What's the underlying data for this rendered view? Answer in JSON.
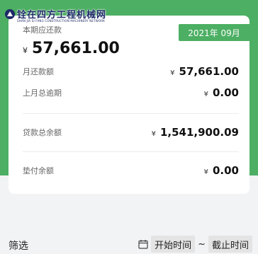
{
  "watermark": {
    "title": "铨在四方工程机械网",
    "subtitle": "SHAN JIA SI FANG CONSTRUCTION MACHINERY NETWORK"
  },
  "summary": {
    "period_label": "本期应还款",
    "month_tag": "2021年 09月",
    "currency": "¥",
    "amount": "57,661.00"
  },
  "rows": [
    {
      "label": "月还款额",
      "currency": "¥",
      "value": "57,661.00"
    },
    {
      "label": "上月总逾期",
      "currency": "¥",
      "value": "0.00"
    },
    {
      "label": "贷款总余额",
      "currency": "¥",
      "value": "1,541,900.09"
    },
    {
      "label": "垫付余额",
      "currency": "¥",
      "value": "0.00"
    }
  ],
  "filter": {
    "label": "筛选",
    "start_label": "开始时间",
    "separator": "~",
    "end_label": "截止时间"
  },
  "colors": {
    "accent": "#4caf63",
    "card": "#ffffff",
    "page": "#f2f3f5"
  }
}
